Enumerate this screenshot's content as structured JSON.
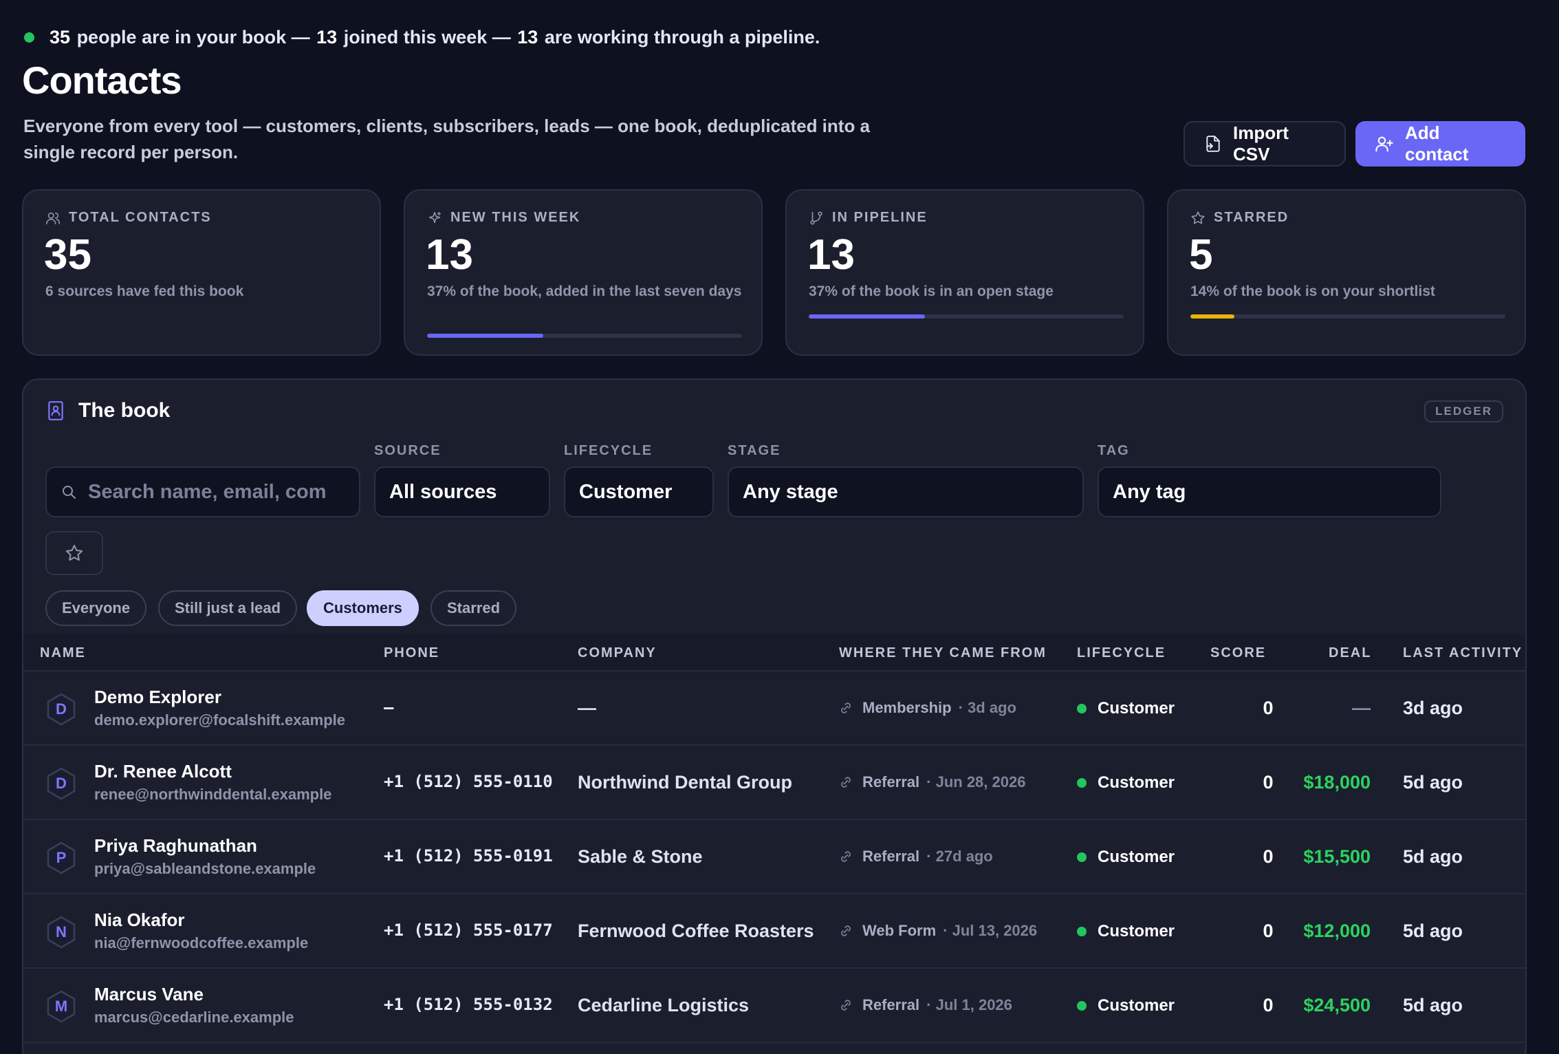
{
  "summary": {
    "total": "35",
    "t1": "people are in your book —",
    "new": "13",
    "t2": "joined this week —",
    "pipeline": "13",
    "t3": "are working through a pipeline."
  },
  "header": {
    "title": "Contacts",
    "subtitle": "Everyone from every tool — customers, clients, subscribers, leads — one book, deduplicated into a single record per person.",
    "import_label": "Import CSV",
    "add_label": "Add contact"
  },
  "stats": [
    {
      "label": "TOTAL CONTACTS",
      "value": "35",
      "caption": "6 sources have fed this book",
      "icon": "users-icon"
    },
    {
      "label": "NEW THIS WEEK",
      "value": "13",
      "caption": "37% of the book, added in the last seven days",
      "progress": 0.37,
      "color": "#6a67f6",
      "icon": "sparkles-icon"
    },
    {
      "label": "IN PIPELINE",
      "value": "13",
      "caption": "37% of the book is in an open stage",
      "progress": 0.37,
      "color": "#6a67f6",
      "icon": "git-branch-icon"
    },
    {
      "label": "STARRED",
      "value": "5",
      "caption": "14% of the book is on your shortlist",
      "progress": 0.14,
      "color": "#eab308",
      "icon": "star-icon"
    }
  ],
  "book": {
    "title": "The book",
    "badge": "LEDGER",
    "filters": {
      "search_placeholder": "Search name, email, company",
      "source_label": "SOURCE",
      "source_value": "All sources",
      "lifecycle_label": "LIFECYCLE",
      "lifecycle_value": "Customer",
      "stage_label": "STAGE",
      "stage_value": "Any stage",
      "tag_label": "TAG",
      "tag_value": "Any tag"
    },
    "chips": [
      "Everyone",
      "Still just a lead",
      "Customers",
      "Starred"
    ],
    "active_chip": "Customers",
    "columns": [
      "NAME",
      "PHONE",
      "COMPANY",
      "WHERE THEY CAME FROM",
      "LIFECYCLE",
      "SCORE",
      "DEAL",
      "LAST ACTIVITY"
    ],
    "rows": [
      {
        "initial": "D",
        "name": "Demo Explorer",
        "email": "demo.explorer@focalshift.example",
        "phone": "–",
        "company": "—",
        "source": "Membership",
        "when": "· 3d ago",
        "lifecycle": "Customer",
        "score": "0",
        "deal": "—",
        "last": "3d ago"
      },
      {
        "initial": "D",
        "name": "Dr. Renee Alcott",
        "email": "renee@northwinddental.example",
        "phone": "+1 (512) 555-0110",
        "company": "Northwind Dental Group",
        "source": "Referral",
        "when": "· Jun 28, 2026",
        "lifecycle": "Customer",
        "score": "0",
        "deal": "$18,000",
        "last": "5d ago"
      },
      {
        "initial": "P",
        "name": "Priya Raghunathan",
        "email": "priya@sableandstone.example",
        "phone": "+1 (512) 555-0191",
        "company": "Sable & Stone",
        "source": "Referral",
        "when": "· 27d ago",
        "lifecycle": "Customer",
        "score": "0",
        "deal": "$15,500",
        "last": "5d ago"
      },
      {
        "initial": "N",
        "name": "Nia Okafor",
        "email": "nia@fernwoodcoffee.example",
        "phone": "+1 (512) 555-0177",
        "company": "Fernwood Coffee Roasters",
        "source": "Web Form",
        "when": "· Jul 13, 2026",
        "lifecycle": "Customer",
        "score": "0",
        "deal": "$12,000",
        "last": "5d ago"
      },
      {
        "initial": "M",
        "name": "Marcus Vane",
        "email": "marcus@cedarline.example",
        "phone": "+1 (512) 555-0132",
        "company": "Cedarline Logistics",
        "source": "Referral",
        "when": "· Jul 1, 2026",
        "lifecycle": "Customer",
        "score": "0",
        "deal": "$24,500",
        "last": "5d ago"
      }
    ]
  }
}
